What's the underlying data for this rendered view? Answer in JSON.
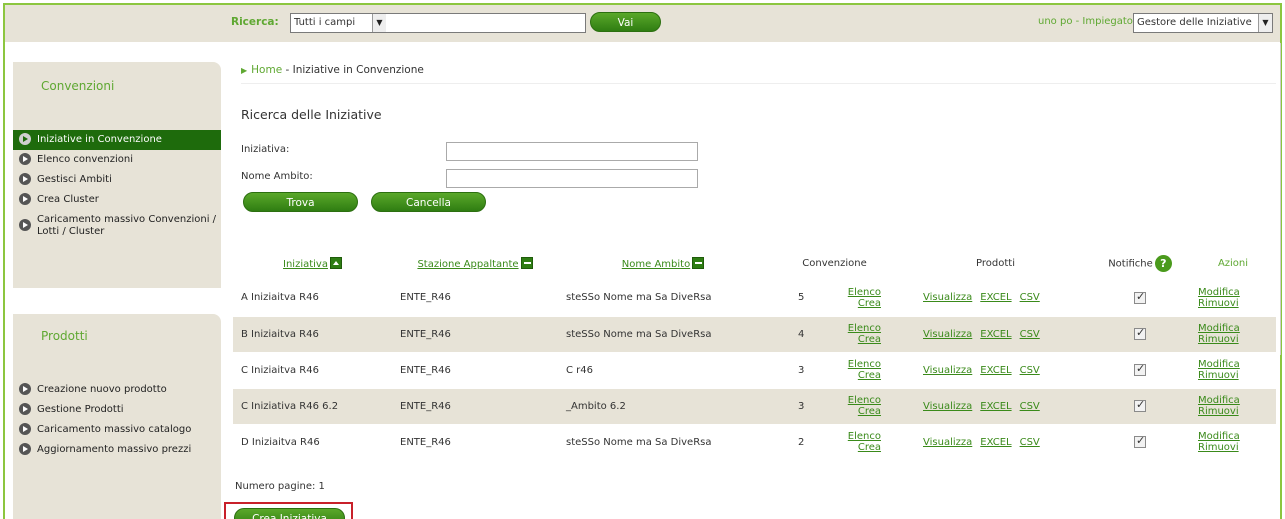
{
  "topbar": {
    "search_label": "Ricerca:",
    "search_scope": "Tutti i campi",
    "search_value": "",
    "go_label": "Vai",
    "user_text": "uno po - Impiegato",
    "role_value": "Gestore delle Iniziative"
  },
  "sidebar": {
    "convenzioni": {
      "title": "Convenzioni",
      "items": [
        {
          "label": "Iniziative in Convenzione",
          "active": true
        },
        {
          "label": "Elenco convenzioni"
        },
        {
          "label": "Gestisci Ambiti"
        },
        {
          "label": "Crea Cluster"
        },
        {
          "label": "Caricamento massivo Convenzioni / Lotti / Cluster"
        }
      ]
    },
    "prodotti": {
      "title": "Prodotti",
      "items": [
        {
          "label": "Creazione nuovo prodotto"
        },
        {
          "label": "Gestione Prodotti"
        },
        {
          "label": "Caricamento massivo catalogo"
        },
        {
          "label": "Aggiornamento massivo prezzi"
        }
      ]
    }
  },
  "breadcrumb": {
    "home": "Home",
    "current": "- Iniziative in Convenzione"
  },
  "search_form": {
    "title": "Ricerca delle Iniziative",
    "iniziativa_label": "Iniziativa:",
    "iniziativa_value": "",
    "nome_ambito_label": "Nome Ambito:",
    "nome_ambito_value": "",
    "trova_label": "Trova",
    "cancella_label": "Cancella"
  },
  "table": {
    "headers": {
      "iniziativa": "Iniziativa",
      "stazione": "Stazione Appaltante",
      "ambito": "Nome Ambito",
      "convenzione": "Convenzione",
      "prodotti": "Prodotti",
      "notifiche": "Notifiche",
      "azioni": "Azioni"
    },
    "rows": [
      {
        "iniziativa": "A Iniziaitva R46",
        "stazione": "ENTE_R46",
        "ambito": "steSSo Nome ma Sa DiveRsa",
        "count": "5",
        "elenco": "Elenco",
        "crea": "Crea",
        "visualizza": "Visualizza",
        "excel": "EXCEL",
        "csv": "CSV",
        "notifica": true,
        "modifica": "Modifica",
        "rimuovi": "Rimuovi"
      },
      {
        "iniziativa": "B Iniziaitva R46",
        "stazione": "ENTE_R46",
        "ambito": "steSSo Nome ma Sa DiveRsa",
        "count": "4",
        "elenco": "Elenco",
        "crea": "Crea",
        "visualizza": "Visualizza",
        "excel": "EXCEL",
        "csv": "CSV",
        "notifica": true,
        "modifica": "Modifica",
        "rimuovi": "Rimuovi"
      },
      {
        "iniziativa": "C Iniziaitva R46",
        "stazione": "ENTE_R46",
        "ambito": "C r46",
        "count": "3",
        "elenco": "Elenco",
        "crea": "Crea",
        "visualizza": "Visualizza",
        "excel": "EXCEL",
        "csv": "CSV",
        "notifica": true,
        "modifica": "Modifica",
        "rimuovi": "Rimuovi"
      },
      {
        "iniziativa": "C Iniziativa R46 6.2",
        "stazione": "ENTE_R46",
        "ambito": "_Ambito 6.2",
        "count": "3",
        "elenco": "Elenco",
        "crea": "Crea",
        "visualizza": "Visualizza",
        "excel": "EXCEL",
        "csv": "CSV",
        "notifica": true,
        "modifica": "Modifica",
        "rimuovi": "Rimuovi"
      },
      {
        "iniziativa": "D Iniziaitva R46",
        "stazione": "ENTE_R46",
        "ambito": "steSSo Nome ma Sa DiveRsa",
        "count": "2",
        "elenco": "Elenco",
        "crea": "Crea",
        "visualizza": "Visualizza",
        "excel": "EXCEL",
        "csv": "CSV",
        "notifica": true,
        "modifica": "Modifica",
        "rimuovi": "Rimuovi"
      }
    ]
  },
  "pagination": {
    "text": "Numero pagine: 1"
  },
  "crea_iniziativa_label": "Crea Iniziativa",
  "icons": {
    "sort_up": "sort-ascending-icon",
    "sort_none": "sort-neutral-icon",
    "help": "help-icon",
    "bullet": "arrow-bullet-icon"
  },
  "colors": {
    "accent": "#5fa832",
    "active_item": "#1e6b0c",
    "panel_bg": "#e7e3d7",
    "highlight_border": "#c8202a"
  }
}
